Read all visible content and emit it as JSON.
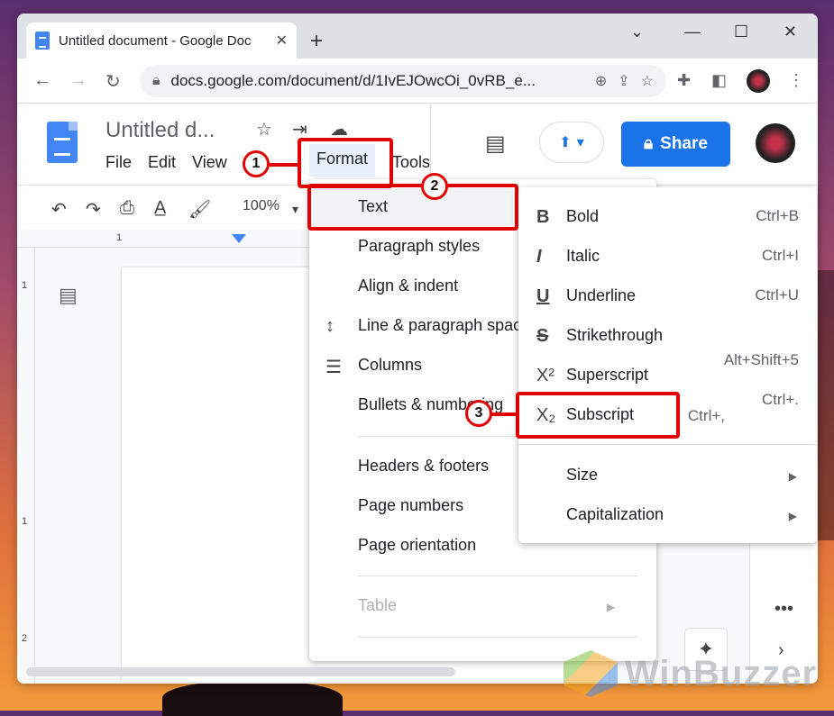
{
  "browser": {
    "tab_title": "Untitled document - Google Doc",
    "url": "docs.google.com/document/d/1IvEJOwcOi_0vRB_e...",
    "new_tab": "+",
    "close_tab": "✕"
  },
  "doc": {
    "title": "Untitled d...",
    "menus": [
      "File",
      "Edit",
      "View",
      "Format",
      "Tools"
    ],
    "share_label": "Share",
    "zoom": "100%"
  },
  "ruler": {
    "h_num": "1",
    "v_nums": [
      "1",
      "1",
      "2"
    ]
  },
  "format_menu": {
    "items": [
      {
        "label": "Text"
      },
      {
        "label": "Paragraph styles"
      },
      {
        "label": "Align & indent"
      },
      {
        "label": "Line & paragraph spacing"
      },
      {
        "label": "Columns"
      },
      {
        "label": "Bullets & numbering"
      },
      {
        "label": "Headers & footers"
      },
      {
        "label": "Page numbers"
      },
      {
        "label": "Page orientation"
      },
      {
        "label": "Table"
      }
    ]
  },
  "text_menu": {
    "items": [
      {
        "label": "Bold",
        "shortcut": "Ctrl+B",
        "icon": "B"
      },
      {
        "label": "Italic",
        "shortcut": "Ctrl+I",
        "icon": "I"
      },
      {
        "label": "Underline",
        "shortcut": "Ctrl+U",
        "icon": "U"
      },
      {
        "label": "Strikethrough",
        "shortcut": "Alt+Shift+5",
        "icon": "S"
      },
      {
        "label": "Superscript",
        "shortcut": "Ctrl+.",
        "icon": "X²"
      },
      {
        "label": "Subscript",
        "shortcut": "Ctrl+,",
        "icon": "X₂"
      },
      {
        "label": "Size",
        "shortcut": ""
      },
      {
        "label": "Capitalization",
        "shortcut": ""
      }
    ]
  },
  "annotations": {
    "step1": "1",
    "step2": "2",
    "step3": "3"
  },
  "watermark": "WinBuzzer",
  "colors": {
    "accent": "#1a73e8",
    "annotation": "#e00000"
  }
}
